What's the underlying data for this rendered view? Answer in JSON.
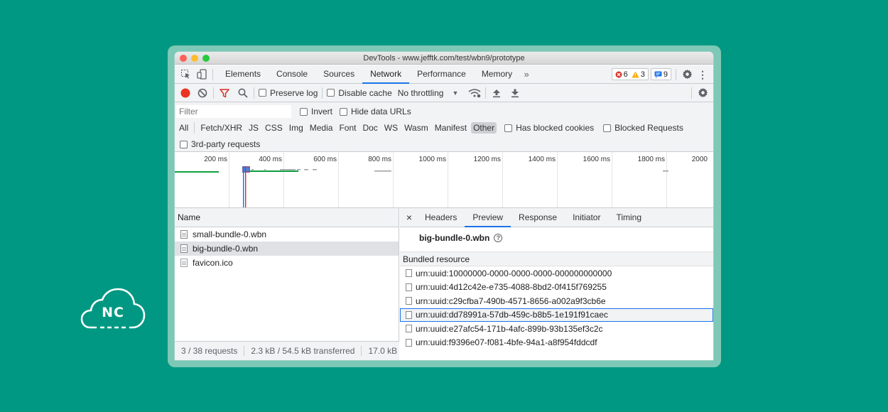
{
  "window": {
    "title": "DevTools - www.jefftk.com/test/wbn9/prototype"
  },
  "logo": {
    "text": "NC"
  },
  "tabs": [
    "Elements",
    "Console",
    "Sources",
    "Network",
    "Performance",
    "Memory"
  ],
  "active_tab": "Network",
  "badges": {
    "errors": "6",
    "warnings": "3",
    "messages": "9"
  },
  "toolbar": {
    "preserve_log": "Preserve log",
    "disable_cache": "Disable cache",
    "throttling": "No throttling"
  },
  "filter": {
    "placeholder": "Filter",
    "invert": "Invert",
    "hide_data_urls": "Hide data URLs",
    "types": [
      "All",
      "Fetch/XHR",
      "JS",
      "CSS",
      "Img",
      "Media",
      "Font",
      "Doc",
      "WS",
      "Wasm",
      "Manifest",
      "Other"
    ],
    "active_type": "Other",
    "has_blocked_cookies": "Has blocked cookies",
    "blocked_requests": "Blocked Requests",
    "third_party": "3rd-party requests"
  },
  "timeline": {
    "ticks": [
      "200 ms",
      "400 ms",
      "600 ms",
      "800 ms",
      "1000 ms",
      "1200 ms",
      "1400 ms",
      "1600 ms",
      "1800 ms",
      "2000"
    ]
  },
  "requests": {
    "header": "Name",
    "items": [
      "small-bundle-0.wbn",
      "big-bundle-0.wbn",
      "favicon.ico"
    ],
    "selected": "big-bundle-0.wbn"
  },
  "status": {
    "requests": "3 / 38 requests",
    "transferred": "2.3 kB / 54.5 kB transferred",
    "resources": "17.0 kB /"
  },
  "details": {
    "tabs": [
      "Headers",
      "Preview",
      "Response",
      "Initiator",
      "Timing"
    ],
    "active": "Preview",
    "bundle_name": "big-bundle-0.wbn",
    "section": "Bundled resource",
    "resources": [
      "urn:uuid:10000000-0000-0000-0000-000000000000",
      "urn:uuid:4d12c42e-e735-4088-8bd2-0f415f769255",
      "urn:uuid:c29cfba7-490b-4571-8656-a002a9f3cb6e",
      "urn:uuid:dd78991a-57db-459c-b8b5-1e191f91caec",
      "urn:uuid:e27afc54-171b-4afc-899b-93b135ef3c2c",
      "urn:uuid:f9396e07-f081-4bfe-94a1-a8f954fddcdf"
    ],
    "selected_index": 3
  },
  "colors": {
    "background": "#009882",
    "accent": "#1a73e8",
    "record": "#ea3323",
    "filter_active": "#d93025"
  }
}
